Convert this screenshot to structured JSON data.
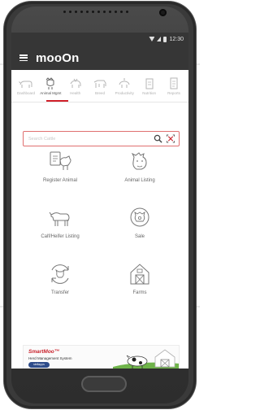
{
  "status": {
    "time": "12:30"
  },
  "app": {
    "title": "mooOn"
  },
  "tabs": [
    {
      "label": "Dashboard",
      "icon": "dashboard-cow-icon",
      "active": false
    },
    {
      "label": "Animal Mgmt",
      "icon": "animal-mgmt-icon",
      "active": true
    },
    {
      "label": "Health",
      "icon": "health-icon",
      "active": false
    },
    {
      "label": "Breed",
      "icon": "breed-icon",
      "active": false
    },
    {
      "label": "Productivity",
      "icon": "productivity-icon",
      "active": false
    },
    {
      "label": "Nutrition",
      "icon": "nutrition-icon",
      "active": false
    },
    {
      "label": "Reports",
      "icon": "reports-icon",
      "active": false
    }
  ],
  "search": {
    "placeholder": "Search Cattle"
  },
  "grid": [
    {
      "label": "Register Animal",
      "icon": "register-animal-icon"
    },
    {
      "label": "Animal Listing",
      "icon": "animal-listing-icon"
    },
    {
      "label": "Calf/Heifer Listing",
      "icon": "calf-icon"
    },
    {
      "label": "Sale",
      "icon": "sale-icon"
    },
    {
      "label": "Transfer",
      "icon": "transfer-icon"
    },
    {
      "label": "Farms",
      "icon": "barn-icon"
    }
  ],
  "banner": {
    "title": "SmartMoo™",
    "subtitle": "Herd Management System",
    "brand": "stellapps"
  },
  "colors": {
    "accent": "#d0202a",
    "appbar": "#363636"
  }
}
